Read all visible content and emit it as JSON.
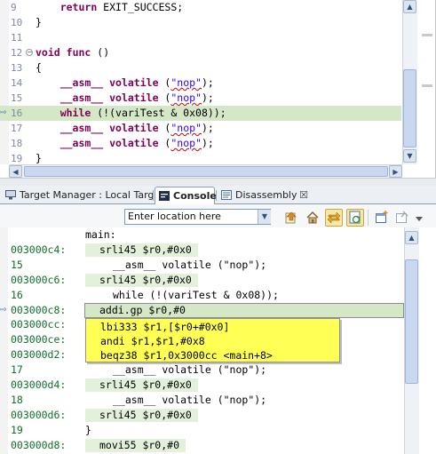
{
  "editor": {
    "lines": [
      {
        "num": "9",
        "tokens": [
          {
            "t": "    "
          },
          {
            "t": "return",
            "c": "kw"
          },
          {
            "t": " EXIT_SUCCESS;"
          }
        ]
      },
      {
        "num": "10",
        "tokens": [
          {
            "t": "}"
          }
        ]
      },
      {
        "num": "11",
        "tokens": []
      },
      {
        "num": "12",
        "fold": "⊖",
        "tokens": [
          {
            "t": "void",
            "c": "kw"
          },
          {
            "t": " "
          },
          {
            "t": "func",
            "c": "kw"
          },
          {
            "t": " ()"
          }
        ]
      },
      {
        "num": "13",
        "tokens": [
          {
            "t": "{"
          }
        ]
      },
      {
        "num": "14",
        "tokens": [
          {
            "t": "    "
          },
          {
            "t": "__asm__",
            "c": "kw"
          },
          {
            "t": " "
          },
          {
            "t": "volatile",
            "c": "kw"
          },
          {
            "t": " ("
          },
          {
            "t": "\"nop\"",
            "c": "str squig"
          },
          {
            "t": ");"
          }
        ]
      },
      {
        "num": "15",
        "tokens": [
          {
            "t": "    "
          },
          {
            "t": "__asm__",
            "c": "kw"
          },
          {
            "t": " "
          },
          {
            "t": "volatile",
            "c": "kw"
          },
          {
            "t": " ("
          },
          {
            "t": "\"nop\"",
            "c": "str squig"
          },
          {
            "t": ");"
          }
        ]
      },
      {
        "num": "16",
        "current": true,
        "tokens": [
          {
            "t": "    "
          },
          {
            "t": "while",
            "c": "kw"
          },
          {
            "t": " (!(variTest & 0x08));"
          }
        ]
      },
      {
        "num": "17",
        "tokens": [
          {
            "t": "    "
          },
          {
            "t": "__asm__",
            "c": "kw"
          },
          {
            "t": " "
          },
          {
            "t": "volatile",
            "c": "kw"
          },
          {
            "t": " ("
          },
          {
            "t": "\"nop\"",
            "c": "str squig"
          },
          {
            "t": ");"
          }
        ]
      },
      {
        "num": "18",
        "tokens": [
          {
            "t": "    "
          },
          {
            "t": "__asm__",
            "c": "kw"
          },
          {
            "t": " "
          },
          {
            "t": "volatile",
            "c": "kw"
          },
          {
            "t": " ("
          },
          {
            "t": "\"nop\"",
            "c": "str squig"
          },
          {
            "t": ");"
          }
        ]
      },
      {
        "num": "19",
        "tokens": [
          {
            "t": "}"
          }
        ]
      }
    ]
  },
  "tabs": {
    "target_manager": "Target Manager : Local Targets",
    "console": "Console",
    "disassembly": "Disassembly",
    "close_glyph": "☒"
  },
  "toolbar": {
    "location_placeholder": "Enter location here",
    "icons": [
      "go-icon",
      "home-icon",
      "sync-icon",
      "refresh-icon",
      "new-view-icon",
      "pin-icon"
    ]
  },
  "disassembly": {
    "rows": [
      {
        "addr": "",
        "kind": "label",
        "text": "main:"
      },
      {
        "addr": "003000c4:",
        "kind": "asm",
        "text": "srli45 $r0,#0x0"
      },
      {
        "addr": "15",
        "kind": "src",
        "text": "__asm__ volatile (\"nop\");"
      },
      {
        "addr": "003000c6:",
        "kind": "asm",
        "text": "srli45 $r0,#0x0"
      },
      {
        "addr": "16",
        "kind": "src",
        "text": "while (!(variTest & 0x08));"
      },
      {
        "addr": "003000c8:",
        "kind": "current",
        "text": "addi.gp $r0,#0"
      },
      {
        "addr": "003000cc:",
        "kind": "asm",
        "text": "lbi333 $r1,[$r0+#0x0]"
      },
      {
        "addr": "003000ce:",
        "kind": "asm",
        "text": "andi $r1,$r1,#0x8"
      },
      {
        "addr": "003000d2:",
        "kind": "asm",
        "text": "beqz38 $r1,0x3000cc <main+8>"
      },
      {
        "addr": "17",
        "kind": "src",
        "text": "__asm__ volatile (\"nop\");"
      },
      {
        "addr": "003000d4:",
        "kind": "asm",
        "text": "srli45 $r0,#0x0"
      },
      {
        "addr": "18",
        "kind": "src",
        "text": "__asm__ volatile (\"nop\");"
      },
      {
        "addr": "003000d6:",
        "kind": "asm",
        "text": "srli45 $r0,#0x0"
      },
      {
        "addr": "19",
        "kind": "plain",
        "text": "}"
      },
      {
        "addr": "003000d8:",
        "kind": "asm",
        "text": "movi55 $r0,#0"
      }
    ],
    "tooltip": [
      "lbi333 $r1,[$r0+#0x0]",
      "andi $r1,$r1,#0x8",
      "beqz38 $r1,0x3000cc <main+8>"
    ]
  },
  "colors": {
    "highlight_line": "#d4e7c6",
    "tooltip_bg": "#ffff55",
    "address_green": "#0e6e2a",
    "keyword": "#7f0055",
    "string": "#2a00ff"
  }
}
